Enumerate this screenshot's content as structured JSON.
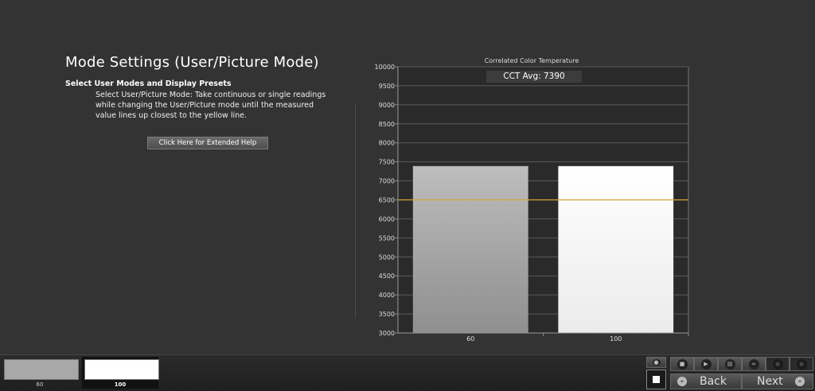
{
  "left": {
    "title": "Mode Settings (User/Picture Mode)",
    "heading": "Select User Modes and Display Presets",
    "body": "Select User/Picture Mode: Take continuous or single readings while changing the User/Picture mode until the measured value lines up closest to the yellow line.",
    "help_button": "Click Here for Extended Help"
  },
  "chart_data": {
    "type": "bar",
    "title": "Correlated Color Temperature",
    "badge": "CCT Avg: 7390",
    "categories": [
      "60",
      "100"
    ],
    "values": [
      7390,
      7390
    ],
    "ylim": [
      3000,
      10000
    ],
    "yticks": [
      3000,
      3500,
      4000,
      4500,
      5000,
      5500,
      6000,
      6500,
      7000,
      7500,
      8000,
      8500,
      9000,
      9500,
      10000
    ],
    "reference_line": 6500,
    "reference_color": "#d6a534",
    "bar_colors": [
      "#a8a8a8",
      "#f2f2f2"
    ],
    "grid": true
  },
  "bottom": {
    "swatches": [
      {
        "label": "60",
        "color": "#a8a8a8",
        "selected": false
      },
      {
        "label": "100",
        "color": "#ffffff",
        "selected": true
      }
    ],
    "back_label": "Back",
    "next_label": "Next"
  }
}
